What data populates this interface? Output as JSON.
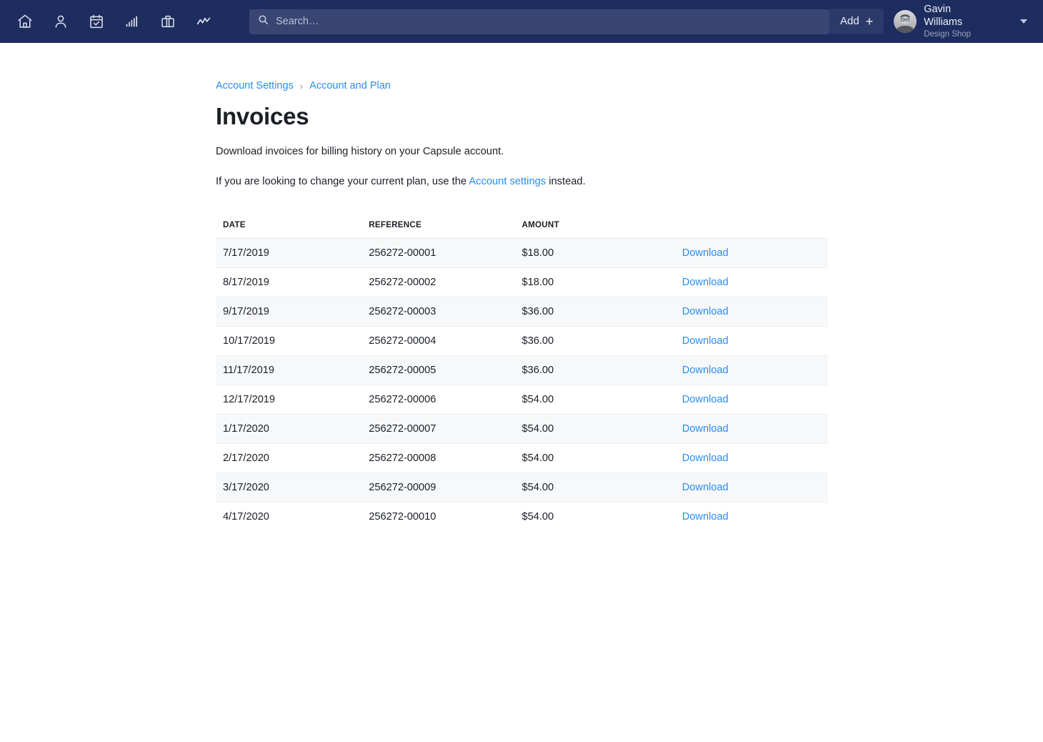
{
  "navbar": {
    "background": "#1e2d5f",
    "icons": [
      {
        "name": "home-icon",
        "label": "Home"
      },
      {
        "name": "person-icon",
        "label": "People"
      },
      {
        "name": "calendar-check-icon",
        "label": "Calendar"
      },
      {
        "name": "bar-chart-icon",
        "label": "Reports"
      },
      {
        "name": "briefcase-icon",
        "label": "Cases"
      },
      {
        "name": "line-chart-icon",
        "label": "Activity"
      }
    ],
    "search": {
      "placeholder": "Search…",
      "value": "",
      "icon": "search-icon"
    },
    "add_button": {
      "label": "Add",
      "plus": "+"
    },
    "user": {
      "name": "Gavin Williams",
      "org": "Design Shop",
      "avatar": "user-avatar-photo",
      "caret": "chevron-down-icon"
    }
  },
  "breadcrumb": {
    "items": [
      {
        "label": "Account Settings"
      },
      {
        "label": "Account and Plan"
      }
    ],
    "separator": "›"
  },
  "main": {
    "title": "Invoices",
    "description": "Download invoices for billing history on your Capsule account.",
    "note_prefix": "If you are looking to change your current plan, use the ",
    "note_link": "Account settings",
    "note_suffix": " instead."
  },
  "table": {
    "columns": [
      "DATE",
      "REFERENCE",
      "AMOUNT",
      ""
    ],
    "action_label": "Download",
    "rows": [
      {
        "date": "7/17/2019",
        "reference": "256272-00001",
        "amount": "$18.00",
        "action": "Download"
      },
      {
        "date": "8/17/2019",
        "reference": "256272-00002",
        "amount": "$18.00",
        "action": "Download"
      },
      {
        "date": "9/17/2019",
        "reference": "256272-00003",
        "amount": "$36.00",
        "action": "Download"
      },
      {
        "date": "10/17/2019",
        "reference": "256272-00004",
        "amount": "$36.00",
        "action": "Download"
      },
      {
        "date": "11/17/2019",
        "reference": "256272-00005",
        "amount": "$36.00",
        "action": "Download"
      },
      {
        "date": "12/17/2019",
        "reference": "256272-00006",
        "amount": "$54.00",
        "action": "Download"
      },
      {
        "date": "1/17/2020",
        "reference": "256272-00007",
        "amount": "$54.00",
        "action": "Download"
      },
      {
        "date": "2/17/2020",
        "reference": "256272-00008",
        "amount": "$54.00",
        "action": "Download"
      },
      {
        "date": "3/17/2020",
        "reference": "256272-00009",
        "amount": "$54.00",
        "action": "Download"
      },
      {
        "date": "4/17/2020",
        "reference": "256272-00010",
        "amount": "$54.00",
        "action": "Download"
      }
    ]
  },
  "colors": {
    "navbar_bg": "#1e2d5f",
    "search_bg": "#394673",
    "link_blue": "#2a8ced",
    "row_alt_bg": "#f7f8f9",
    "text": "#1b1f26"
  }
}
